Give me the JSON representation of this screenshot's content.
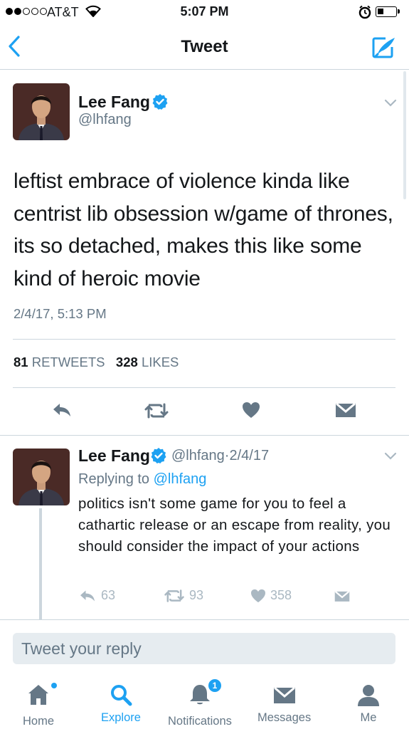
{
  "status_bar": {
    "carrier": "AT&T",
    "time": "5:07 PM"
  },
  "nav": {
    "title": "Tweet"
  },
  "main_tweet": {
    "author_name": "Lee Fang",
    "handle": "@lhfang",
    "text": "leftist embrace of violence kinda like centrist lib obsession w/game of thrones, its so detached, makes this like some kind of heroic movie",
    "date": "2/4/17, 5:13 PM",
    "retweets_count": "81",
    "retweets_label": "RETWEETS",
    "likes_count": "328",
    "likes_label": "LIKES"
  },
  "reply_tweet": {
    "author_name": "Lee Fang",
    "handle": "@lhfang",
    "separator": "·",
    "date": "2/4/17",
    "replying_prefix": "Replying to",
    "replying_handle": "@lhfang",
    "text": "politics isn't some game for you to feel a cathartic release or an escape from reality, you should consider the impact of your actions",
    "reply_count": "63",
    "retweet_count": "93",
    "like_count": "358"
  },
  "reply_box": {
    "placeholder": "Tweet your reply"
  },
  "tab_bar": {
    "tabs": [
      {
        "label": "Home"
      },
      {
        "label": "Explore"
      },
      {
        "label": "Notifications",
        "badge": "1"
      },
      {
        "label": "Messages"
      },
      {
        "label": "Me"
      }
    ],
    "active": "Explore"
  },
  "colors": {
    "accent": "#1da1f2",
    "secondary_text": "#657786",
    "divider": "#ccd6dd"
  }
}
